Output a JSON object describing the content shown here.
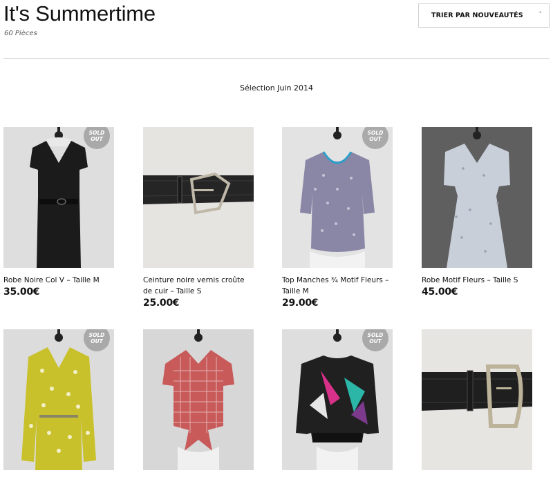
{
  "header": {
    "title": "It's Summertime",
    "count": "60 Pièces",
    "sort_label": "TRIER PAR NOUVEAUTÉS",
    "sort_chevron": "ˇ"
  },
  "section": {
    "subtitle": "Sélection Juin 2014"
  },
  "badge": {
    "line1": "SOLD",
    "line2": "OUT"
  },
  "products": [
    {
      "name": "Robe Noire Col V – Taille M",
      "price": "35.00€",
      "sold_out": true
    },
    {
      "name": "Ceinture noire vernis croûte de cuir – Taille S",
      "price": "25.00€",
      "sold_out": false
    },
    {
      "name": "Top Manches ¾ Motif Fleurs – Taille M",
      "price": "29.00€",
      "sold_out": true
    },
    {
      "name": "Robe Motif Fleurs – Taille S",
      "price": "45.00€",
      "sold_out": false
    },
    {
      "name": "",
      "price": "",
      "sold_out": true
    },
    {
      "name": "",
      "price": "",
      "sold_out": false
    },
    {
      "name": "",
      "price": "",
      "sold_out": true
    },
    {
      "name": "",
      "price": "",
      "sold_out": false
    }
  ],
  "colors": {
    "sold_badge": "#a0a0a0",
    "divider": "#d6d6d6"
  }
}
